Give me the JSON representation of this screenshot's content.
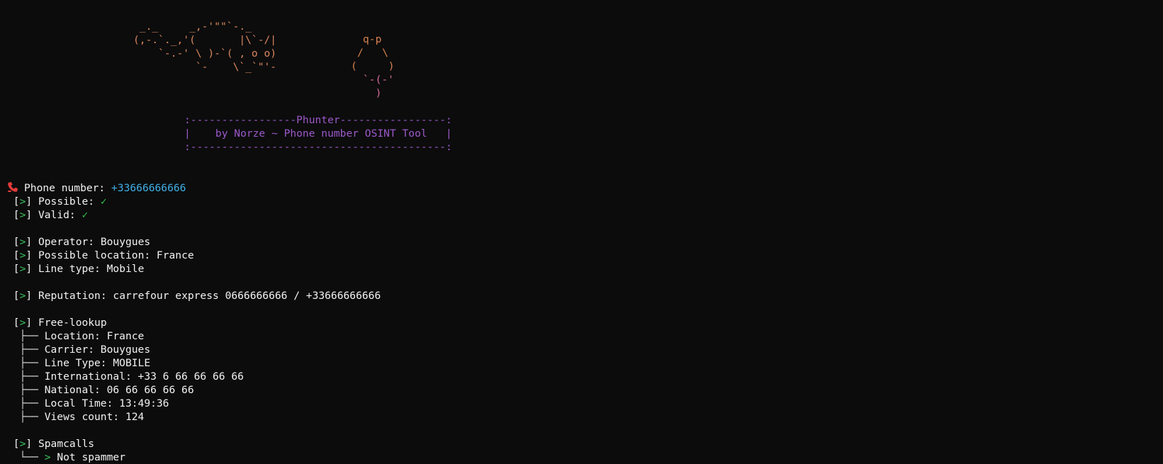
{
  "ascii_art": {
    "cat": [
      " _._     _,-'\"\"`-._",
      "(,-.`._,'(       |\\`-/|",
      "    `-.-' \\ )-`( , o o)",
      "          `-    \\`_`\"'-"
    ],
    "pin_top": [
      "q-p",
      "/   \\",
      "(     )"
    ],
    "pin_bottom": [
      "`-(-'",
      "  )"
    ],
    "banner": [
      ":-----------------Phunter-----------------:",
      "|    by Norze ~ Phone number OSINT Tool   |",
      ":-----------------------------------------:"
    ]
  },
  "prompt_marker": ">",
  "check_mark": "✓",
  "phone": {
    "icon": "phone-receiver-icon",
    "label": "Phone number: ",
    "value": "+33666666666"
  },
  "checks": {
    "possible": "Possible: ",
    "valid": "Valid: "
  },
  "info": {
    "operator": "Operator: Bouygues",
    "location": "Possible location: France",
    "line_type": "Line type: Mobile"
  },
  "reputation": "Reputation: carrefour express 0666666666 / +33666666666",
  "free_lookup": {
    "title": "Free-lookup",
    "branch": "├──",
    "items": [
      "Location: France",
      "Carrier: Bouygues",
      "Line Type: MOBILE",
      "International: +33 6 66 66 66 66",
      "National: 06 66 66 66 66",
      "Local Time: 13:49:36",
      "Views count: 124"
    ]
  },
  "spamcalls": {
    "title": "Spamcalls",
    "branch": "└──",
    "result": "Not spammer"
  },
  "colors": {
    "background": "#0c0c0c",
    "text": "#f2f2f2",
    "accent_blue": "#3fb0e6",
    "accent_green": "#39c25a",
    "banner_purple": "#9b59c9",
    "ascii_orange": "#d9865f"
  }
}
